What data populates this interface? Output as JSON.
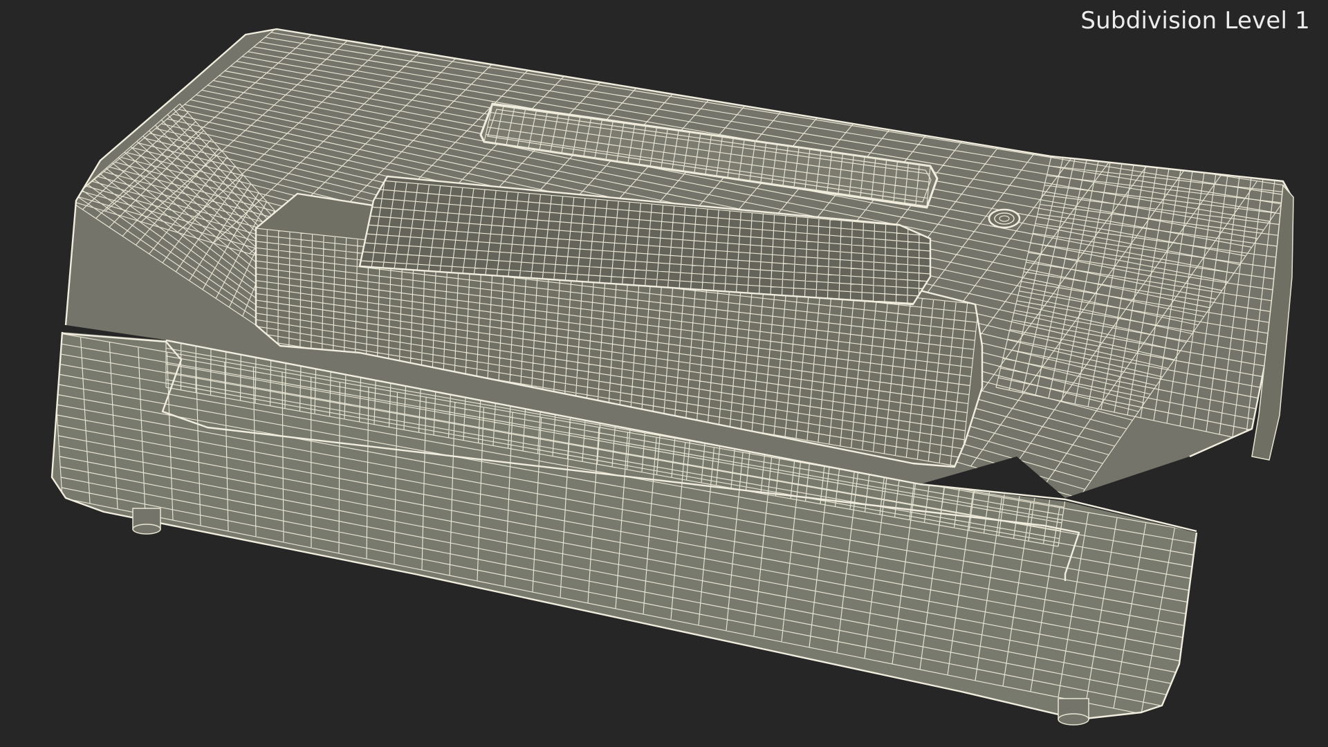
{
  "viewport": {
    "subdivision_label": "Subdivision Level 1",
    "background_color": "#262626",
    "mesh_fill_color": "#77776b",
    "mesh_wire_color": "#e9e6d4"
  }
}
